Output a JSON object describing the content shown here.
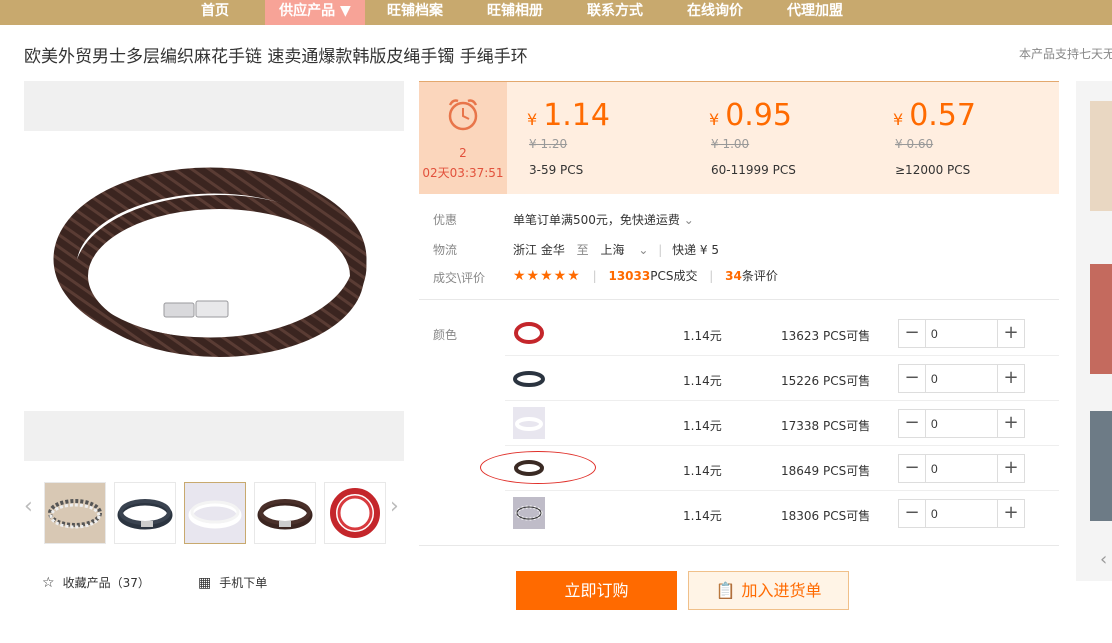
{
  "nav": {
    "items": [
      {
        "label": "首页"
      },
      {
        "label": "供应产品 ▼"
      },
      {
        "label": "旺铺档案"
      },
      {
        "label": "旺铺相册"
      },
      {
        "label": "联系方式"
      },
      {
        "label": "在线询价"
      },
      {
        "label": "代理加盟"
      }
    ],
    "active_index": 1
  },
  "product": {
    "title": "欧美外贸男士多层编织麻花手链 速卖通爆款韩版皮绳手镯 手绳手环",
    "notice": "本产品支持七天无"
  },
  "countdown": {
    "days": "2",
    "time": "02天03:37:51",
    "icon": "alarm-clock-icon"
  },
  "price_tiers": [
    {
      "currency": "¥",
      "price": "1.14",
      "old_price": "¥ 1.20",
      "range": "3-59  PCS"
    },
    {
      "currency": "¥",
      "price": "0.95",
      "old_price": "¥ 1.00",
      "range": "60-11999  PCS"
    },
    {
      "currency": "¥",
      "price": "0.57",
      "old_price": "¥ 0.60",
      "range": "≥12000  PCS"
    }
  ],
  "info": {
    "promo_label": "优惠",
    "promo_text": "单笔订单满500元，免快递运费",
    "logistics_label": "物流",
    "from": "浙江  金华",
    "to_word": "至",
    "to": "上海",
    "express": "快递 ¥ 5",
    "review_label": "成交\\评价",
    "stars": "★★★★★",
    "deals_num": "13033",
    "deals_suffix": "PCS成交",
    "reviews_num": "34",
    "reviews_suffix": "条评价"
  },
  "sku": {
    "label": "颜色",
    "rows": [
      {
        "price": "1.14元",
        "stock": "13623 PCS可售",
        "qty": "0",
        "color": "#c4262b"
      },
      {
        "price": "1.14元",
        "stock": "15226 PCS可售",
        "qty": "0",
        "color": "#2b3440"
      },
      {
        "price": "1.14元",
        "stock": "17338 PCS可售",
        "qty": "0",
        "color": "#e8e6ef"
      },
      {
        "price": "1.14元",
        "stock": "18649 PCS可售",
        "qty": "0",
        "color": "#3a2a24"
      },
      {
        "price": "1.14元",
        "stock": "18306 PCS可售",
        "qty": "0",
        "color": "#bfbcc8"
      }
    ]
  },
  "actions": {
    "buy": "立即订购",
    "cart": "加入进货单",
    "favorite": "收藏产品（37）",
    "mobile": "手机下单"
  },
  "colors": {
    "nav_bg": "#c8a96e",
    "nav_active": "#f7a397",
    "accent": "#ff6a00",
    "price_bg": "#ffeee0"
  }
}
